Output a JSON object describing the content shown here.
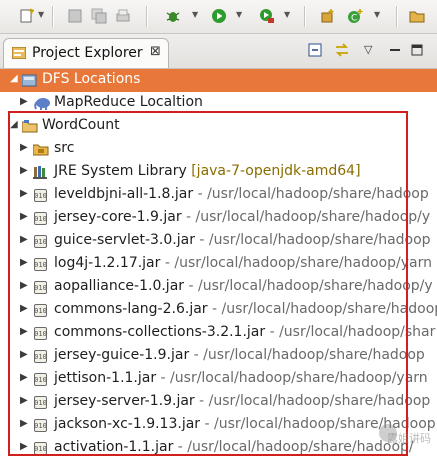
{
  "toolbar": {
    "buttons": [
      "new",
      "save",
      "save-all",
      "print",
      "debug",
      "run",
      "external-tools",
      "new-java-package",
      "new-java-class",
      "open-perspective"
    ]
  },
  "view": {
    "title": "Project Explorer",
    "close_glyph": "⊠"
  },
  "tree": {
    "rows": [
      {
        "label": "DFS Locations",
        "path": "",
        "icon": "dfs-icon",
        "expanded": true,
        "selected": true
      },
      {
        "label": "MapReduce Localtion",
        "path": "",
        "icon": "elephant-icon",
        "expanded": false
      },
      {
        "label": "WordCount",
        "path": "",
        "icon": "project-folder-icon",
        "expanded": true
      },
      {
        "label": "src",
        "path": "",
        "icon": "package-folder-icon",
        "expanded": false
      },
      {
        "label": "JRE System Library ",
        "lib": "[java-7-openjdk-amd64]",
        "icon": "library-icon",
        "expanded": false
      },
      {
        "label": "leveldbjni-all-1.8.jar",
        "path": " - /usr/local/hadoop/share/hadoop",
        "icon": "jar-icon"
      },
      {
        "label": "jersey-core-1.9.jar",
        "path": " - /usr/local/hadoop/share/hadoop/y",
        "icon": "jar-icon"
      },
      {
        "label": "guice-servlet-3.0.jar",
        "path": " - /usr/local/hadoop/share/hadoop",
        "icon": "jar-icon"
      },
      {
        "label": "log4j-1.2.17.jar",
        "path": " - /usr/local/hadoop/share/hadoop/yarn",
        "icon": "jar-icon"
      },
      {
        "label": "aopalliance-1.0.jar",
        "path": " - /usr/local/hadoop/share/hadoop/y",
        "icon": "jar-icon"
      },
      {
        "label": "commons-lang-2.6.jar",
        "path": " - /usr/local/hadoop/share/hadoop",
        "icon": "jar-icon"
      },
      {
        "label": "commons-collections-3.2.1.jar",
        "path": " - /usr/local/hadoop/shar",
        "icon": "jar-icon"
      },
      {
        "label": "jersey-guice-1.9.jar",
        "path": " - /usr/local/hadoop/share/hadoop",
        "icon": "jar-icon"
      },
      {
        "label": "jettison-1.1.jar",
        "path": " - /usr/local/hadoop/share/hadoop/yarn",
        "icon": "jar-icon"
      },
      {
        "label": "jersey-server-1.9.jar",
        "path": " - /usr/local/hadoop/share/hadoop",
        "icon": "jar-icon"
      },
      {
        "label": "jackson-xc-1.9.13.jar",
        "path": " - /usr/local/hadoop/share/hadoop",
        "icon": "jar-icon"
      },
      {
        "label": "activation-1.1.jar",
        "path": " - /usr/local/hadoop/share/hadoop/",
        "icon": "jar-icon"
      }
    ]
  },
  "watermark": {
    "text": "露姐讲码"
  },
  "colors": {
    "selection": "#e8783a",
    "highlight_box": "#d01f1f",
    "path_text": "#6a6a6a",
    "library_text": "#8a6d00"
  }
}
